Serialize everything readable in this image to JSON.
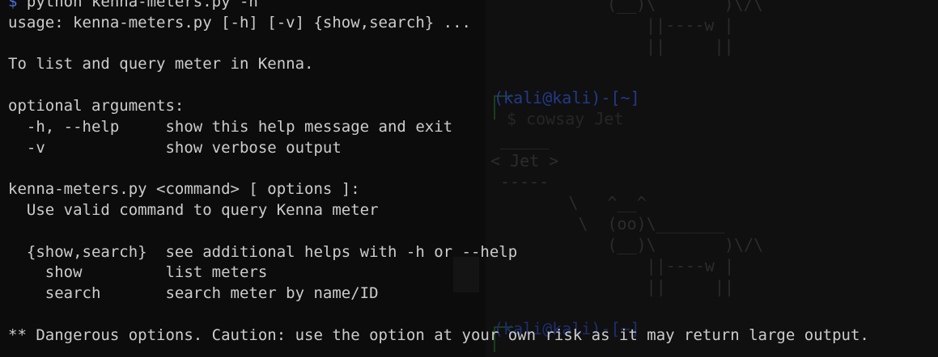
{
  "background_window": {
    "art_top": "(__)\\       )\\/\\\n    ||----w |\n    ||     ||",
    "prompt_user": "(kali@kali)-[~]",
    "prompt_cmd": "$ cowsay Jet",
    "cow_art": " _____\n< Jet >\n -----\n        \\   ^__^\n         \\  (oo)\\_______\n            (__)\\       )\\/\\\n                ||----w |\n                ||     ||",
    "prompt_user_2": "(kali@kali)-[~]"
  },
  "terminal": {
    "prompt_symbol": "$",
    "command": " python kenna-meters.py -h",
    "lines": [
      "usage: kenna-meters.py [-h] [-v] {show,search} ...",
      "",
      "To list and query meter in Kenna.",
      "",
      "optional arguments:",
      "  -h, --help     show this help message and exit",
      "  -v             show verbose output",
      "",
      "kenna-meters.py <command> [ options ]:",
      "  Use valid command to query Kenna meter",
      "",
      "  {show,search}  see additional helps with -h or --help",
      "    show         list meters",
      "    search       search meter by name/ID",
      "",
      "** Dangerous options. Caution: use the option at your own risk as it may return large output."
    ]
  },
  "colors": {
    "background": "#0c0c0c",
    "text": "#cccccc",
    "prompt": "#4e6fd6"
  }
}
